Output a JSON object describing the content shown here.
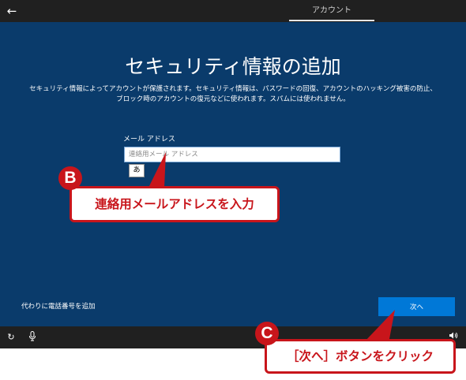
{
  "header": {
    "back_icon": "arrow-left-icon",
    "tab_label": "アカウント"
  },
  "main": {
    "title": "セキュリティ情報の追加",
    "description_line1": "セキュリティ情報によってアカウントが保護されます。セキュリティ情報は、パスワードの回復、アカウントのハッキング被害の防止、",
    "description_line2": "ブロック時のアカウントの復元などに使われます。スパムには使われません。",
    "email_label": "メール アドレス",
    "email_placeholder": "連絡用メール アドレス",
    "email_value": "",
    "ime_mode": "あ",
    "phone_link": "代わりに電話番号を追加",
    "next_button": "次へ",
    "accent_color": "#0078d7",
    "background_color": "#0a3b6b"
  },
  "bottombar": {
    "icons": [
      "ease-of-access-icon",
      "microphone-icon",
      "volume-icon"
    ]
  },
  "annotations": {
    "b_badge": "B",
    "b_text": "連絡用メールアドレスを入力",
    "c_badge": "C",
    "c_text": "［次へ］ボタンをクリック",
    "color": "#c8151b"
  }
}
